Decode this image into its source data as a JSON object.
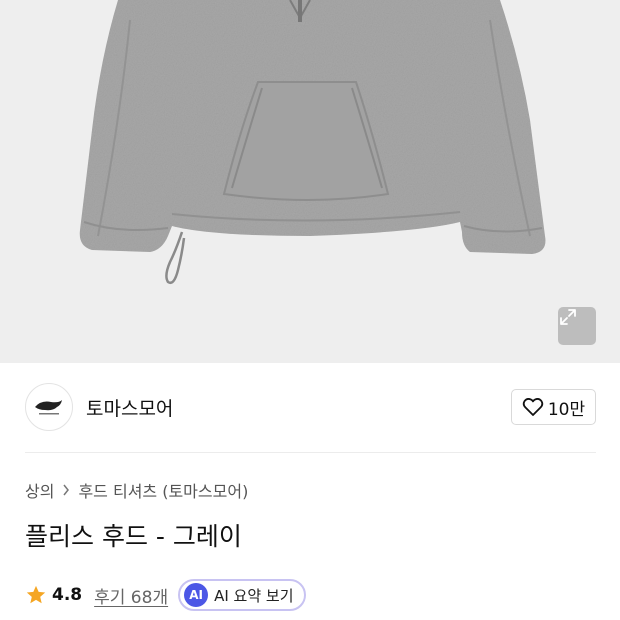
{
  "product_image": {
    "alt": "",
    "expand_icon": "expand-arrows-icon"
  },
  "brand": {
    "name": "토마스모어",
    "logo_icon": "whale-logo-icon",
    "like_count": "10만",
    "like_icon": "heart-outline-icon"
  },
  "breadcrumb": {
    "items": [
      "상의",
      "후드 티셔츠 (토마스모어)"
    ],
    "separator_icon": "chevron-right-icon"
  },
  "product": {
    "title": "플리스 후드 - 그레이"
  },
  "rating": {
    "value": "4.8",
    "star_icon": "star-icon",
    "star_color": "#f5a623",
    "review_text": "후기 68개",
    "ai_badge": "AI",
    "ai_summary_label": "AI 요약 보기",
    "ai_color": "#4c57e6"
  }
}
